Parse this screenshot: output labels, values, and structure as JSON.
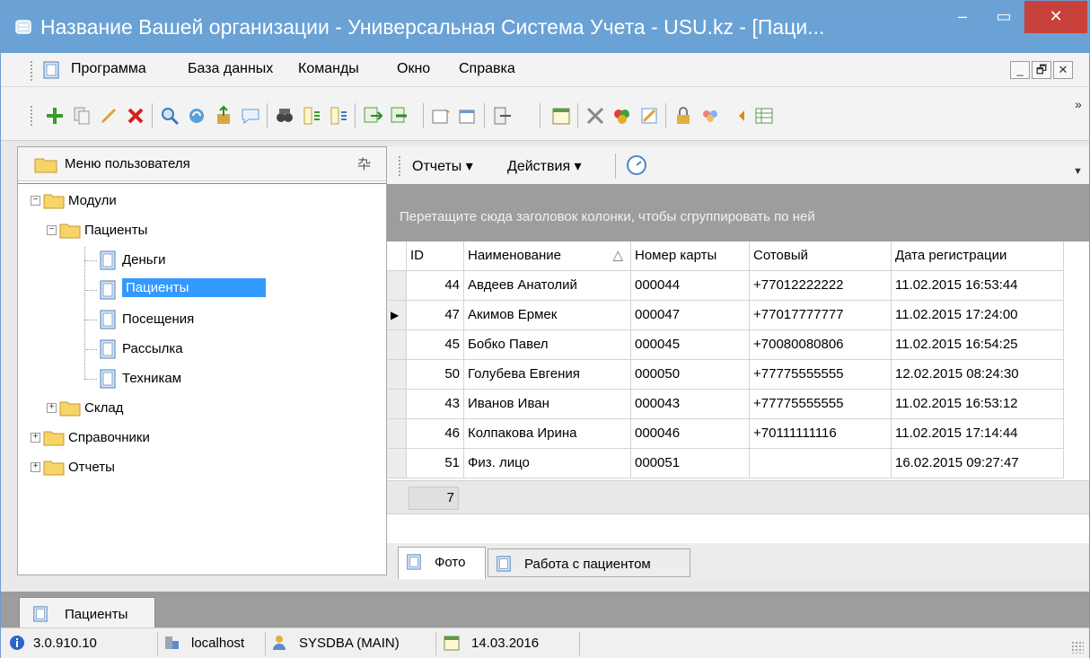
{
  "window": {
    "title": "Название Вашей организации - Универсальная Система Учета - USU.kz - [Паци...",
    "controls": {
      "minimize": "–",
      "maximize": "▭",
      "close": "✕"
    }
  },
  "menubar": {
    "items": [
      "Программа",
      "База данных",
      "Команды",
      "Окно",
      "Справка"
    ],
    "mdi_buttons": [
      "_",
      "🗗",
      "✕"
    ]
  },
  "toolbar": {
    "icons": [
      "add-icon",
      "copy-icon",
      "edit-icon",
      "delete-icon",
      "search-icon",
      "refresh-icon",
      "export-icon",
      "comment-icon",
      "filter-icon",
      "sort-asc-icon",
      "sort-desc-icon",
      "import-icon",
      "import-arrow-icon",
      "new-window-icon",
      "window-icon",
      "exit-icon",
      "calendar-icon",
      "tools-icon",
      "paint-icon",
      "notes-icon",
      "lock-icon",
      "users-icon",
      "plugin-icon",
      "table-icon"
    ],
    "more": "»"
  },
  "left_panel": {
    "header": "Меню пользователя",
    "pin": "卆",
    "tree": [
      {
        "label": "Модули",
        "level": 0,
        "expander": "−"
      },
      {
        "label": "Пациенты",
        "level": 1,
        "expander": "−"
      },
      {
        "label": "Деньги",
        "level": 2
      },
      {
        "label": "Пациенты",
        "level": 2,
        "selected": true
      },
      {
        "label": "Посещения",
        "level": 2
      },
      {
        "label": "Рассылка",
        "level": 2
      },
      {
        "label": "Техникам",
        "level": 2
      },
      {
        "label": "Склад",
        "level": 1,
        "expander": "+"
      },
      {
        "label": "Справочники",
        "level": 0,
        "expander": "+"
      },
      {
        "label": "Отчеты",
        "level": 0,
        "expander": "+"
      }
    ]
  },
  "right_panel": {
    "menu": {
      "reports": "Отчеты ▾",
      "actions": "Действия ▾"
    },
    "group_hint": "Перетащите сюда заголовок колонки, чтобы сгруппировать по ней",
    "grid": {
      "columns": [
        "ID",
        "Наименование",
        "Номер карты",
        "Сотовый",
        "Дата регистрации"
      ],
      "sort_indicator": "△",
      "rows": [
        [
          "44",
          "Авдеев Анатолий",
          "000044",
          "+77012222222",
          "11.02.2015 16:53:44"
        ],
        [
          "47",
          "Акимов Ермек",
          "000047",
          "+77017777777",
          "11.02.2015 17:24:00"
        ],
        [
          "45",
          "Бобко Павел",
          "000045",
          "+70080080806",
          "11.02.2015 16:54:25"
        ],
        [
          "50",
          "Голубева Евгения",
          "000050",
          "+77775555555",
          "12.02.2015 08:24:30"
        ],
        [
          "43",
          "Иванов Иван",
          "000043",
          "+77775555555",
          "11.02.2015 16:53:12"
        ],
        [
          "46",
          "Колпакова Ирина",
          "000046",
          "+70111111116",
          "11.02.2015 17:14:44"
        ],
        [
          "51",
          "Физ. лицо",
          "000051",
          "",
          "16.02.2015 09:27:47"
        ]
      ],
      "current_row_marker": "▶",
      "row_count": "7"
    },
    "tabs": [
      "Фото",
      "Работа с пациентом"
    ]
  },
  "document_tab": "Пациенты",
  "statusbar": {
    "version": "3.0.910.10",
    "host": "localhost",
    "user": "SYSDBA (MAIN)",
    "date": "14.03.2016"
  },
  "colors": {
    "titlebar": "#6aa2d6",
    "close_button": "#c8413a",
    "selection": "#3399ff",
    "group_area": "#9d9d9d"
  }
}
